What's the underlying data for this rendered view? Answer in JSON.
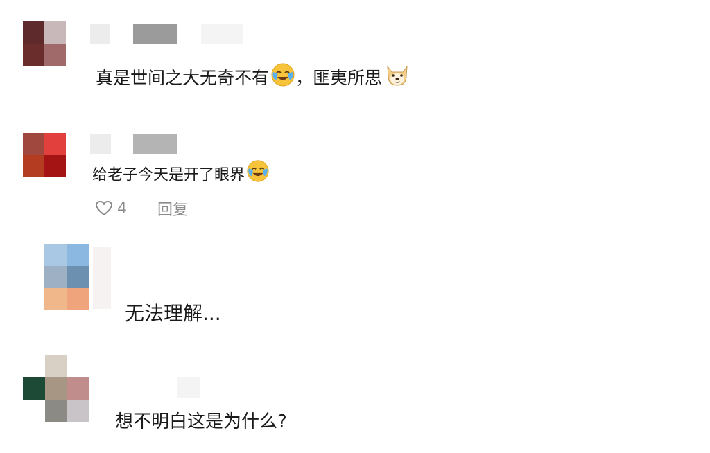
{
  "comments": [
    {
      "text": "真是世间之大无奇不有",
      "emoji": "cry-laugh-emoji",
      "suffix": "，匪夷所思",
      "suffix_emoji": "doge-emoji",
      "avatar_colors": [
        "#5e2a2c",
        "#c8b8b9",
        "#6b2c2c",
        "#a06a6a"
      ]
    },
    {
      "text": "给老子今天是开了眼界",
      "emoji": "cry-laugh-emoji",
      "avatar_colors": [
        "#a0483e",
        "#e2403c",
        "#b43c20",
        "#a51414"
      ],
      "likes": "4",
      "reply_label": "回复"
    },
    {
      "text": "无法理解...",
      "avatar_colors": [
        "#a8c8e4",
        "#8ab8e0",
        "#9eb0c4",
        "#6c90b0",
        "#f0b88a",
        "#f0a47c"
      ]
    },
    {
      "text": "想不明白这是为什么?",
      "avatar_colors": [
        "#d8d0c4",
        "#1d4a36",
        "#a89684",
        "#c08c8c",
        "#8c8a84",
        "#c8c4c8"
      ]
    }
  ],
  "icons": {
    "like": "heart-outline-icon",
    "emoji_laugh": "cry-laugh-emoji",
    "emoji_doge": "doge-emoji"
  },
  "colors": {
    "background": "#ffffff",
    "text": "#1a1a1a",
    "meta": "#8a8a8a"
  }
}
